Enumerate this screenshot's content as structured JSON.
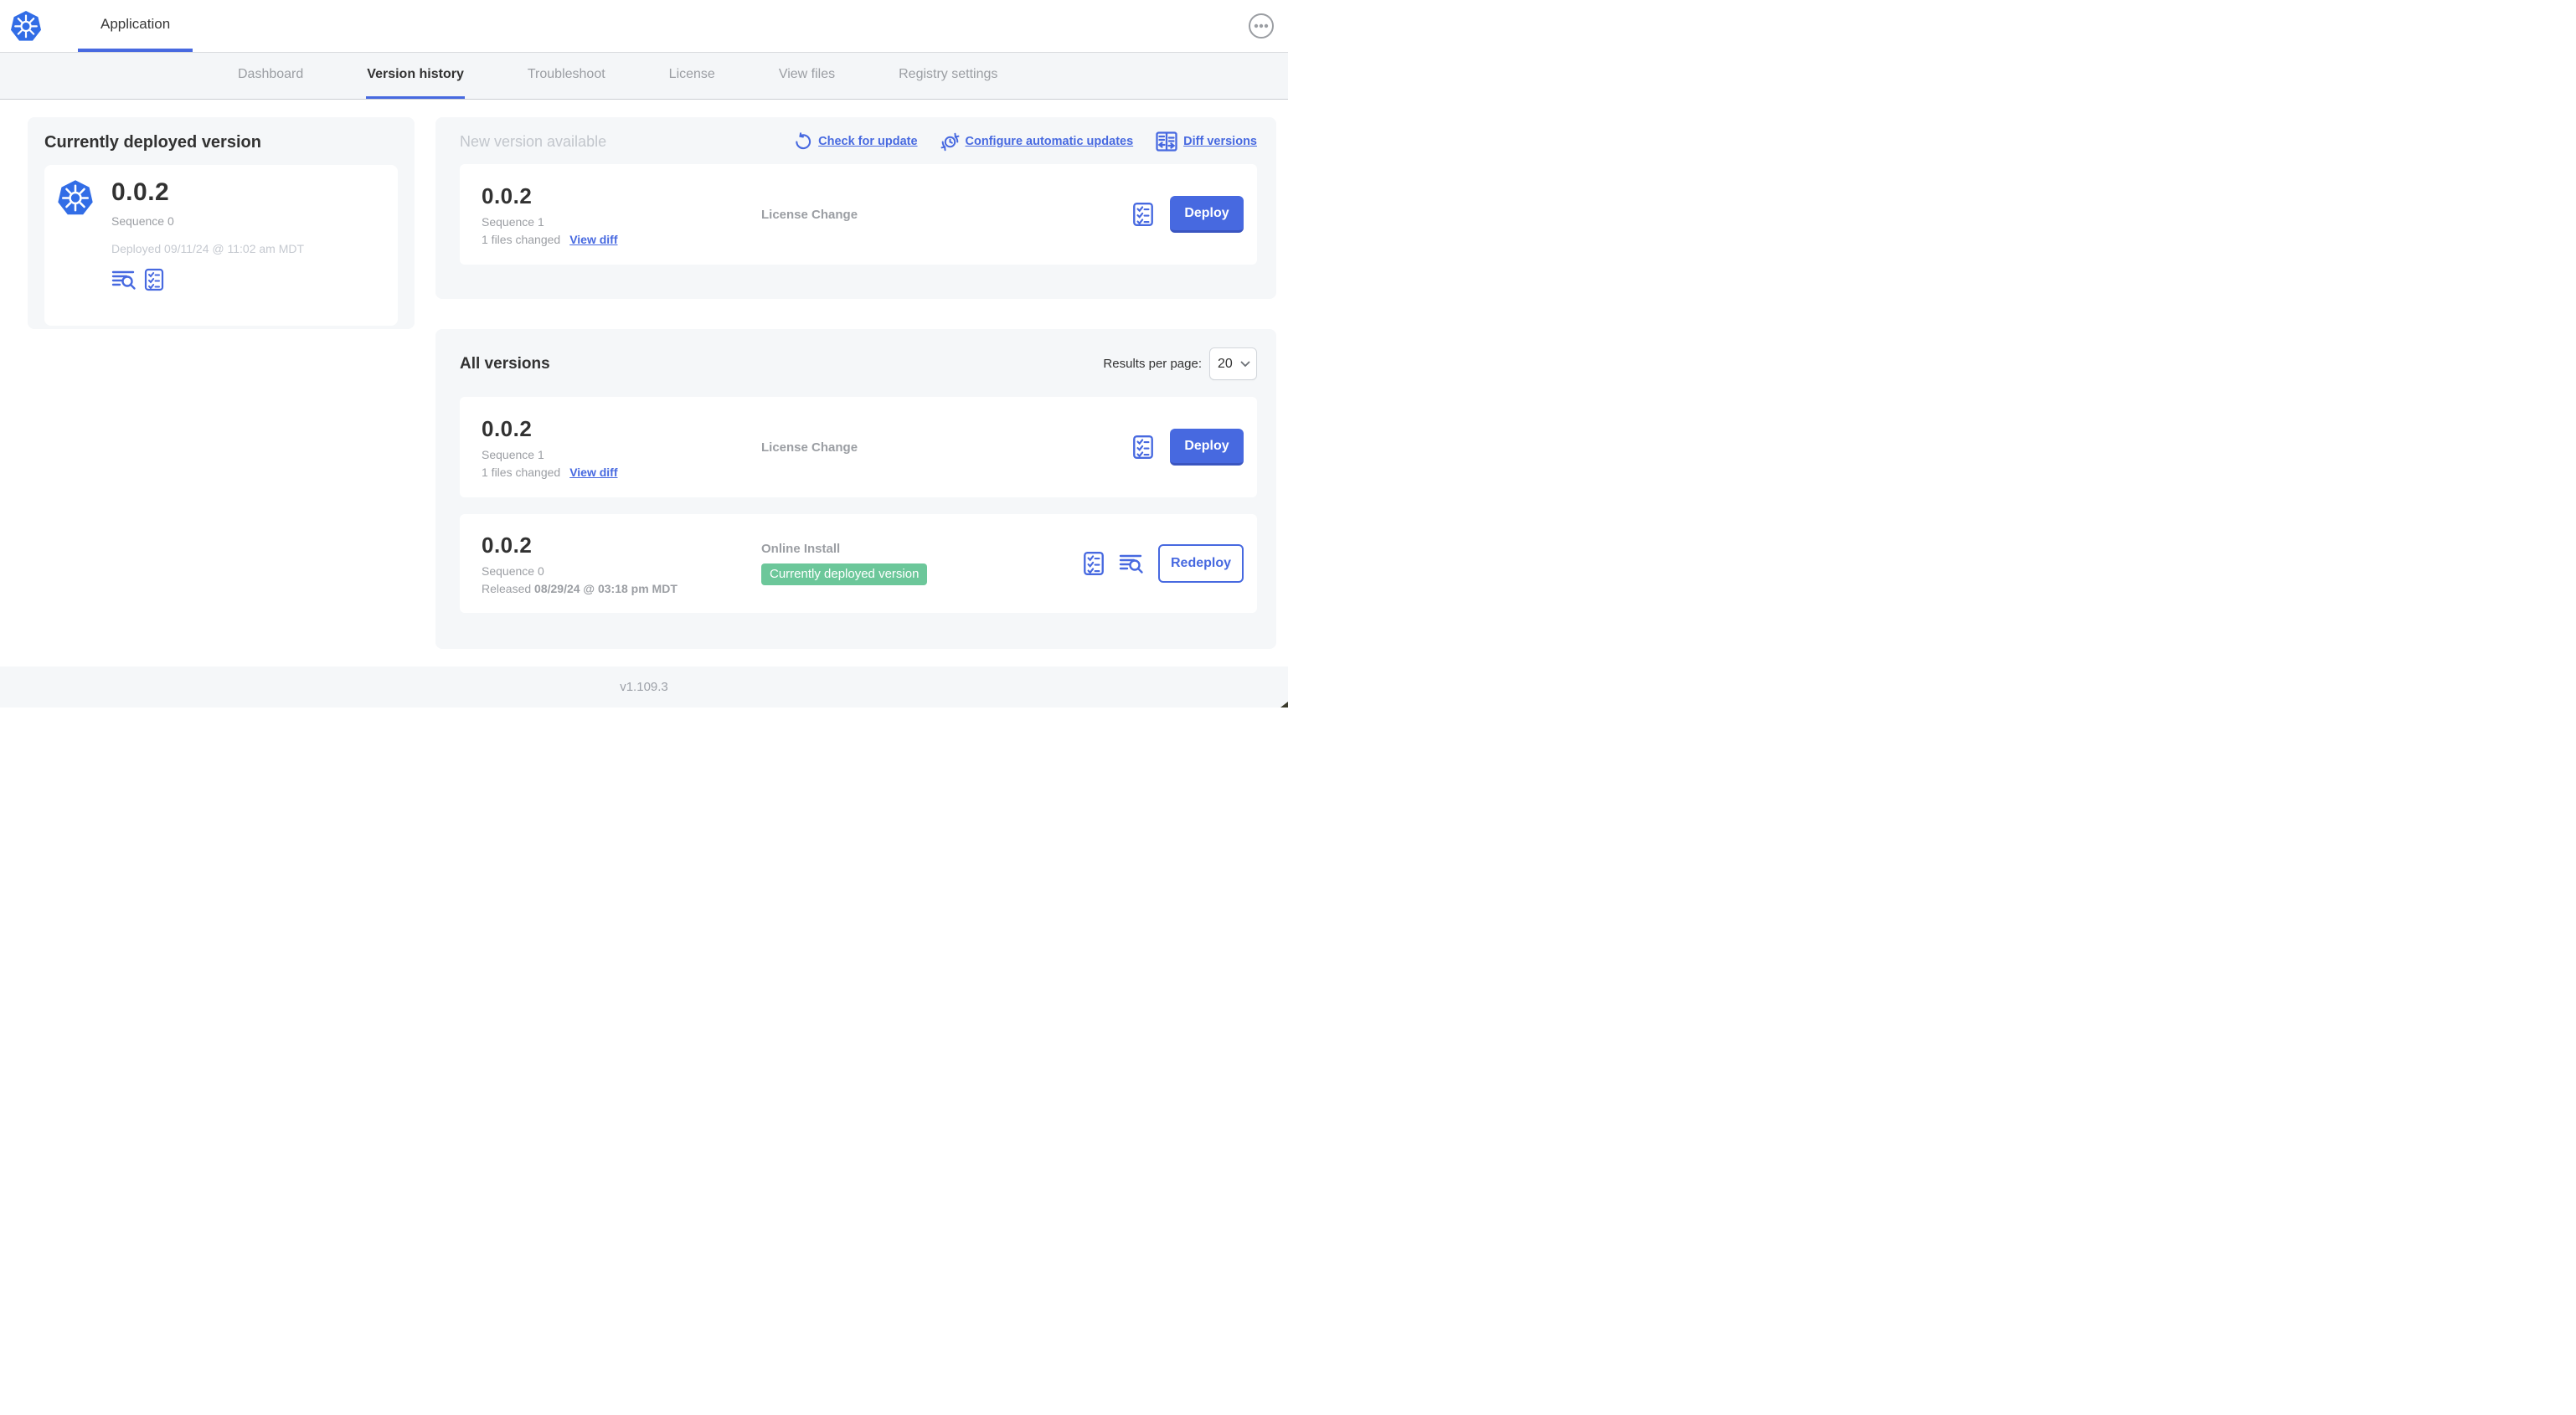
{
  "header": {
    "app_name": "Application"
  },
  "nav": {
    "tabs": [
      "Dashboard",
      "Version history",
      "Troubleshoot",
      "License",
      "View files",
      "Registry settings"
    ],
    "active_tab": "Version history"
  },
  "deployed": {
    "title": "Currently deployed version",
    "version": "0.0.2",
    "sequence": "Sequence 0",
    "deployed_at": "Deployed 09/11/24 @ 11:02 am MDT"
  },
  "new_version": {
    "title": "New version available",
    "actions": [
      {
        "label": "Check for update",
        "icon": "refresh-icon"
      },
      {
        "label": "Configure automatic updates",
        "icon": "clock-refresh-icon"
      },
      {
        "label": "Diff versions",
        "icon": "diff-icon"
      }
    ],
    "row": {
      "version": "0.0.2",
      "sequence": "Sequence 1",
      "files_changed": "1 files changed",
      "view_diff_label": "View diff",
      "source": "License Change",
      "action_label": "Deploy"
    }
  },
  "all_versions": {
    "title": "All versions",
    "results_per_page_label": "Results per page:",
    "results_per_page_value": "20",
    "rows": [
      {
        "version": "0.0.2",
        "sequence": "Sequence 1",
        "files_changed": "1 files changed",
        "view_diff_label": "View diff",
        "source": "License Change",
        "action_label": "Deploy"
      },
      {
        "version": "0.0.2",
        "sequence": "Sequence 0",
        "released_prefix": "Released ",
        "released_date": "08/29/24 @ 03:18 pm MDT",
        "source": "Online Install",
        "badge": "Currently deployed version",
        "action_label": "Redeploy"
      }
    ]
  },
  "footer": {
    "app_version": "v1.109.3"
  },
  "colors": {
    "accent_blue": "#4769E0",
    "accent_blue_dark": "#3A55C0",
    "kubernetes_blue": "#326DE6",
    "badge_green": "#6CC79A",
    "panel_gray": "#F5F7F9",
    "nav_gray": "#F4F6F8",
    "text_dark": "#323232",
    "text_gray": "#9B9EA3",
    "text_light_gray": "#C5C9D0"
  }
}
